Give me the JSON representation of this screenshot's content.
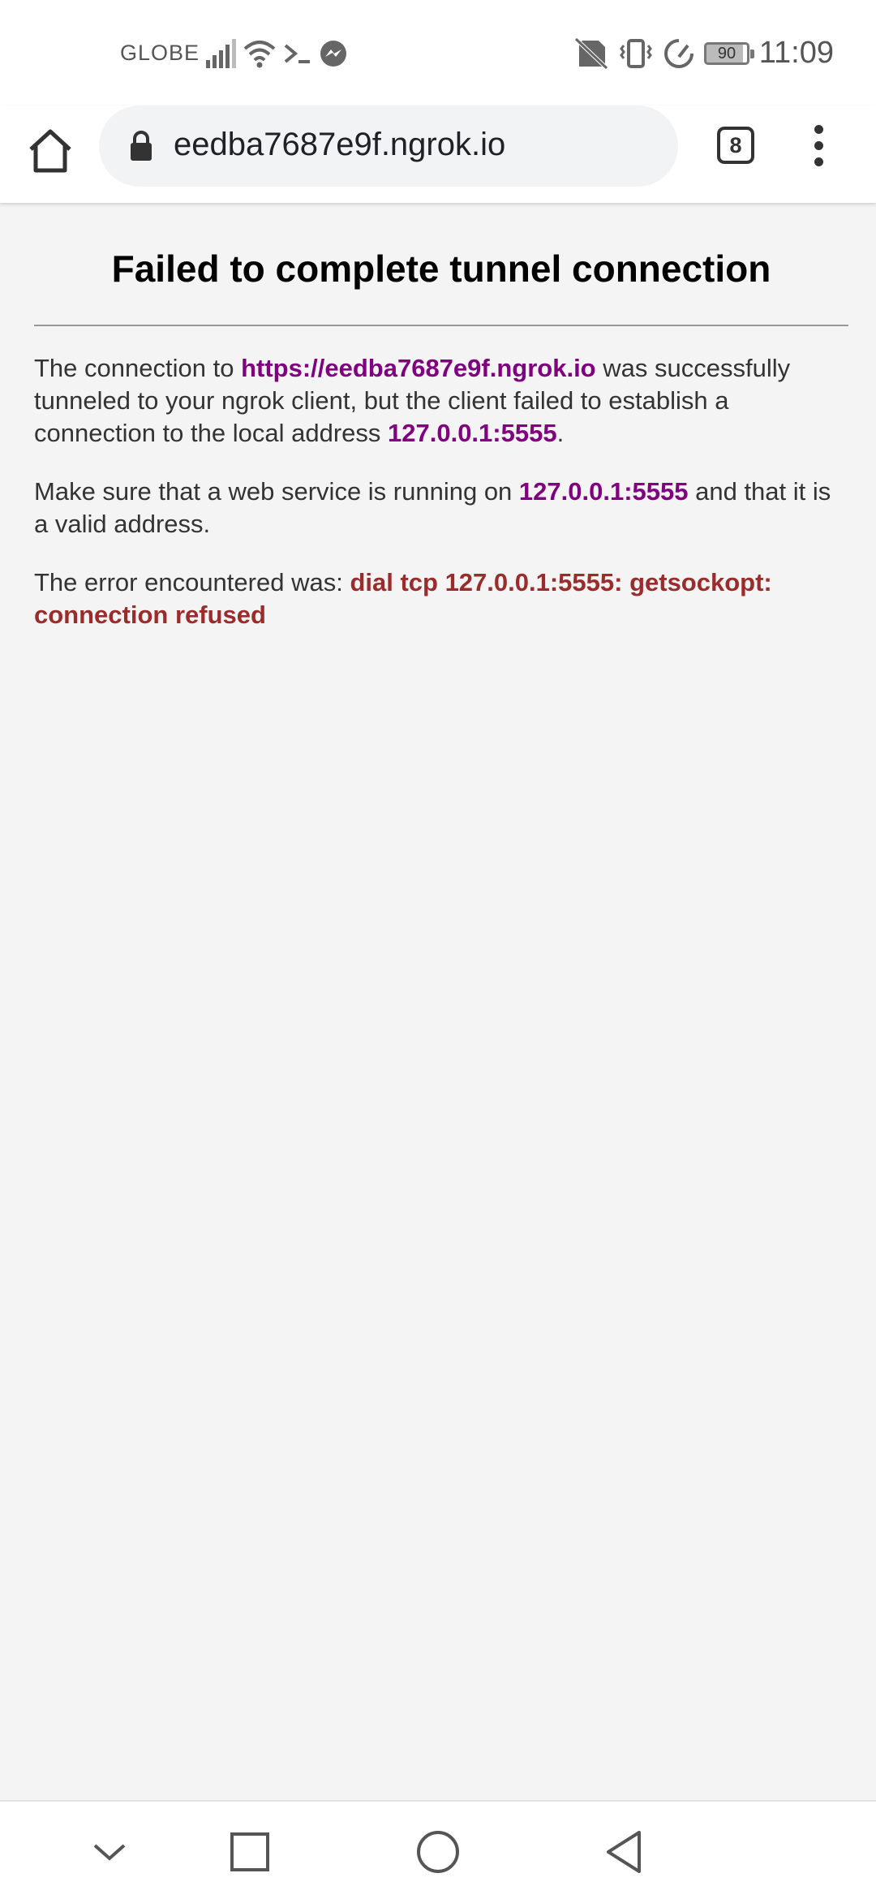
{
  "status_bar": {
    "carrier": "GLOBE",
    "battery": "90",
    "time": "11:09",
    "icons": [
      "signal-icon",
      "wifi-icon",
      "terminal-icon",
      "messenger-icon",
      "no-sim-icon",
      "vibrate-icon",
      "data-saver-icon",
      "battery-icon"
    ]
  },
  "toolbar": {
    "url": "eedba7687e9f.ngrok.io",
    "tab_count": "8"
  },
  "page": {
    "title": "Failed to complete tunnel connection",
    "p1_a": "The connection to ",
    "p1_url": "https://eedba7687e9f.ngrok.io",
    "p1_b": " was successfully tunneled to your ngrok client, but the client failed to establish a connection to the local address ",
    "p1_addr": "127.0.0.1:5555",
    "p1_c": ".",
    "p2_a": "Make sure that a web service is running on ",
    "p2_addr": "127.0.0.1:5555",
    "p2_b": " and that it is a valid address.",
    "p3_a": "The error encountered was: ",
    "p3_err": "dial tcp 127.0.0.1:5555: getsockopt: connection refused"
  },
  "colors": {
    "link": "#800080",
    "error": "#9b2c2c",
    "background": "#f4f4f4"
  }
}
